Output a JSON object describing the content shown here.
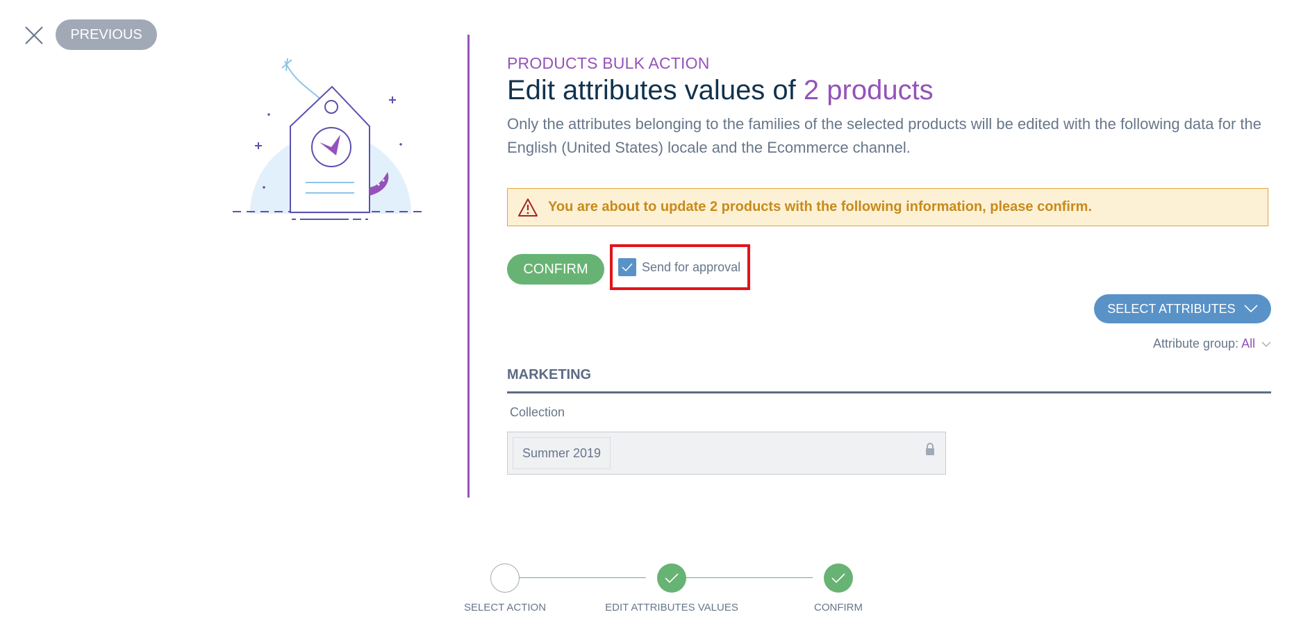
{
  "header": {
    "close_icon": "close-icon",
    "previous_label": "PREVIOUS"
  },
  "main": {
    "section_label": "PRODUCTS BULK ACTION",
    "title_prefix": "Edit attributes values of ",
    "title_accent": "2 products",
    "description": "Only the attributes belonging to the families of the selected products will be edited with the following data for the English (United States) locale and the Ecommerce channel.",
    "warning": {
      "icon": "warning-icon",
      "text": "You are about to update 2 products with the following information, please confirm."
    },
    "confirm_label": "CONFIRM",
    "send_for_approval": {
      "label": "Send for approval",
      "checked": true
    },
    "select_attributes_label": "SELECT ATTRIBUTES",
    "attribute_group": {
      "label": "Attribute group:",
      "value": "All"
    },
    "group": {
      "title": "MARKETING",
      "fields": [
        {
          "label": "Collection",
          "value": "Summer 2019",
          "locked": true
        }
      ]
    }
  },
  "stepper": {
    "steps": [
      {
        "label": "SELECT ACTION",
        "state": "todo"
      },
      {
        "label": "EDIT ATTRIBUTES VALUES",
        "state": "done"
      },
      {
        "label": "CONFIRM",
        "state": "done"
      }
    ]
  },
  "colors": {
    "brand_purple": "#9452ba",
    "confirm_green": "#67b373",
    "action_blue": "#5992c7",
    "warning_orange": "#c88a1a",
    "warning_bg": "#fdf1d5",
    "highlight_red": "#e3131b"
  }
}
